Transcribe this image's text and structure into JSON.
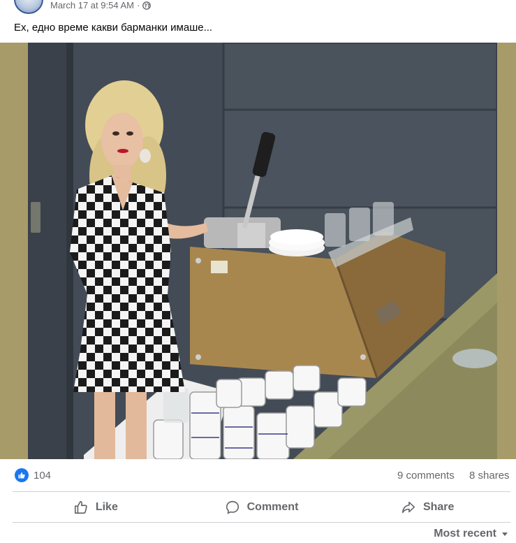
{
  "post": {
    "timestamp": "March 17 at 9:54 AM",
    "separator": "·",
    "privacy_icon": "globe-icon",
    "caption": "Ех, едно време какви барманки имаше..."
  },
  "photo": {
    "icon": "photo-image",
    "subject": "woman-in-checkered-dress-at-espresso-machine"
  },
  "stats": {
    "reaction_icon": "like-icon",
    "likes": "104",
    "comments": "9 comments",
    "shares": "8 shares"
  },
  "actions": {
    "like_label": "Like",
    "comment_label": "Comment",
    "share_label": "Share"
  },
  "comments_sort": {
    "label": "Most recent",
    "icon": "caret-down-icon"
  },
  "colors": {
    "facebook_blue": "#1877f2",
    "secondary_text": "#65676b",
    "divider": "#ced0d4"
  }
}
